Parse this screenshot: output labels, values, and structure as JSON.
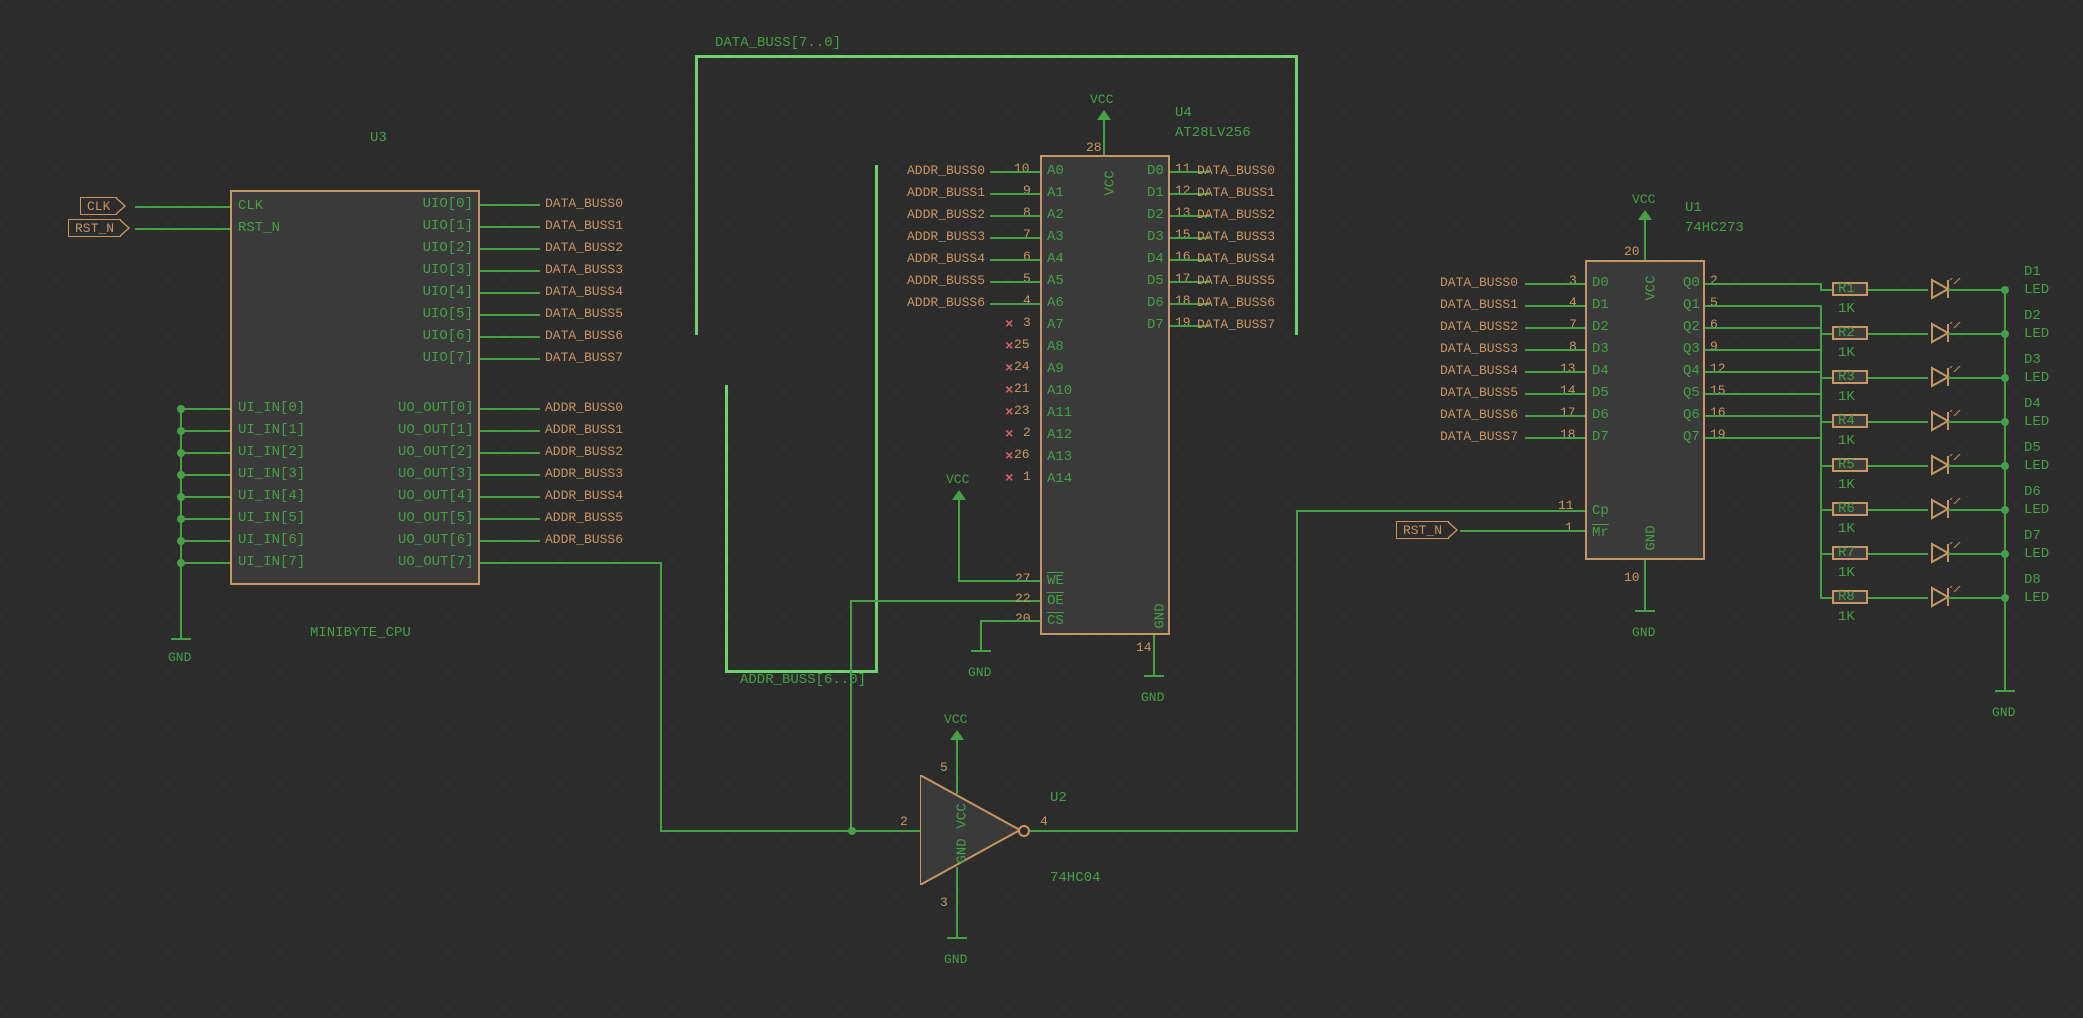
{
  "buses": {
    "data": "DATA_BUSS[7..0]",
    "addr": "ADDR_BUSS[6..0]"
  },
  "global_labels": {
    "clk": "CLK",
    "rst_n": "RST_N"
  },
  "power": {
    "vcc": "VCC",
    "gnd": "GND"
  },
  "u3": {
    "ref": "U3",
    "value": "MINIBYTE_CPU",
    "pins_left_top": [
      "CLK",
      "RST_N"
    ],
    "pins_left_bottom": [
      "UI_IN[0]",
      "UI_IN[1]",
      "UI_IN[2]",
      "UI_IN[3]",
      "UI_IN[4]",
      "UI_IN[5]",
      "UI_IN[6]",
      "UI_IN[7]"
    ],
    "pins_right_top": [
      "UIO[0]",
      "UIO[1]",
      "UIO[2]",
      "UIO[3]",
      "UIO[4]",
      "UIO[5]",
      "UIO[6]",
      "UIO[7]"
    ],
    "pins_right_bottom": [
      "UO_OUT[0]",
      "UO_OUT[1]",
      "UO_OUT[2]",
      "UO_OUT[3]",
      "UO_OUT[4]",
      "UO_OUT[5]",
      "UO_OUT[6]",
      "UO_OUT[7]"
    ],
    "data_nets": [
      "DATA_BUSS0",
      "DATA_BUSS1",
      "DATA_BUSS2",
      "DATA_BUSS3",
      "DATA_BUSS4",
      "DATA_BUSS5",
      "DATA_BUSS6",
      "DATA_BUSS7"
    ],
    "addr_nets": [
      "ADDR_BUSS0",
      "ADDR_BUSS1",
      "ADDR_BUSS2",
      "ADDR_BUSS3",
      "ADDR_BUSS4",
      "ADDR_BUSS5",
      "ADDR_BUSS6"
    ]
  },
  "u4": {
    "ref": "U4",
    "value": "AT28LV256",
    "left_pins": [
      {
        "name": "A0",
        "num": "10",
        "net": "ADDR_BUSS0"
      },
      {
        "name": "A1",
        "num": "9",
        "net": "ADDR_BUSS1"
      },
      {
        "name": "A2",
        "num": "8",
        "net": "ADDR_BUSS2"
      },
      {
        "name": "A3",
        "num": "7",
        "net": "ADDR_BUSS3"
      },
      {
        "name": "A4",
        "num": "6",
        "net": "ADDR_BUSS4"
      },
      {
        "name": "A5",
        "num": "5",
        "net": "ADDR_BUSS5"
      },
      {
        "name": "A6",
        "num": "4",
        "net": "ADDR_BUSS6"
      },
      {
        "name": "A7",
        "num": "3",
        "net": ""
      },
      {
        "name": "A8",
        "num": "25",
        "net": ""
      },
      {
        "name": "A9",
        "num": "24",
        "net": ""
      },
      {
        "name": "A10",
        "num": "21",
        "net": ""
      },
      {
        "name": "A11",
        "num": "23",
        "net": ""
      },
      {
        "name": "A12",
        "num": "2",
        "net": ""
      },
      {
        "name": "A13",
        "num": "26",
        "net": ""
      },
      {
        "name": "A14",
        "num": "1",
        "net": ""
      }
    ],
    "right_pins": [
      {
        "name": "D0",
        "num": "11",
        "net": "DATA_BUSS0"
      },
      {
        "name": "D1",
        "num": "12",
        "net": "DATA_BUSS1"
      },
      {
        "name": "D2",
        "num": "13",
        "net": "DATA_BUSS2"
      },
      {
        "name": "D3",
        "num": "15",
        "net": "DATA_BUSS3"
      },
      {
        "name": "D4",
        "num": "16",
        "net": "DATA_BUSS4"
      },
      {
        "name": "D5",
        "num": "17",
        "net": "DATA_BUSS5"
      },
      {
        "name": "D6",
        "num": "18",
        "net": "DATA_BUSS6"
      },
      {
        "name": "D7",
        "num": "19",
        "net": "DATA_BUSS7"
      }
    ],
    "ctrl_pins": [
      {
        "name": "WE",
        "num": "27",
        "overline": true
      },
      {
        "name": "OE",
        "num": "22",
        "overline": true
      },
      {
        "name": "CS",
        "num": "20",
        "overline": true
      }
    ],
    "vcc_num": "28",
    "gnd_num": "14",
    "internal_vcc": "VCC",
    "internal_gnd": "GND"
  },
  "u1": {
    "ref": "U1",
    "value": "74HC273",
    "left_pins": [
      {
        "name": "D0",
        "num": "3",
        "net": "DATA_BUSS0"
      },
      {
        "name": "D1",
        "num": "4",
        "net": "DATA_BUSS1"
      },
      {
        "name": "D2",
        "num": "7",
        "net": "DATA_BUSS2"
      },
      {
        "name": "D3",
        "num": "8",
        "net": "DATA_BUSS3"
      },
      {
        "name": "D4",
        "num": "13",
        "net": "DATA_BUSS4"
      },
      {
        "name": "D5",
        "num": "14",
        "net": "DATA_BUSS5"
      },
      {
        "name": "D6",
        "num": "17",
        "net": "DATA_BUSS6"
      },
      {
        "name": "D7",
        "num": "18",
        "net": "DATA_BUSS7"
      }
    ],
    "right_pins": [
      {
        "name": "Q0",
        "num": "2"
      },
      {
        "name": "Q1",
        "num": "5"
      },
      {
        "name": "Q2",
        "num": "6"
      },
      {
        "name": "Q3",
        "num": "9"
      },
      {
        "name": "Q4",
        "num": "12"
      },
      {
        "name": "Q5",
        "num": "15"
      },
      {
        "name": "Q6",
        "num": "16"
      },
      {
        "name": "Q7",
        "num": "19"
      }
    ],
    "cp_name": "Cp",
    "cp_num": "11",
    "mr_name": "Mr",
    "mr_num": "1",
    "mr_overline": true,
    "vcc_num": "20",
    "gnd_num": "10",
    "internal_vcc": "VCC",
    "internal_gnd": "GND"
  },
  "u2": {
    "ref": "U2",
    "value": "74HC04",
    "in_num": "2",
    "out_num": "4",
    "vcc_num": "5",
    "gnd_num": "3",
    "internal_vcc": "VCC",
    "internal_gnd": "GND"
  },
  "resistors": [
    {
      "ref": "R1",
      "val": "1K"
    },
    {
      "ref": "R2",
      "val": "1K"
    },
    {
      "ref": "R3",
      "val": "1K"
    },
    {
      "ref": "R4",
      "val": "1K"
    },
    {
      "ref": "R5",
      "val": "1K"
    },
    {
      "ref": "R6",
      "val": "1K"
    },
    {
      "ref": "R7",
      "val": "1K"
    },
    {
      "ref": "R8",
      "val": "1K"
    }
  ],
  "leds": [
    {
      "ref": "D1",
      "val": "LED"
    },
    {
      "ref": "D2",
      "val": "LED"
    },
    {
      "ref": "D3",
      "val": "LED"
    },
    {
      "ref": "D4",
      "val": "LED"
    },
    {
      "ref": "D5",
      "val": "LED"
    },
    {
      "ref": "D6",
      "val": "LED"
    },
    {
      "ref": "D7",
      "val": "LED"
    },
    {
      "ref": "D8",
      "val": "LED"
    }
  ]
}
